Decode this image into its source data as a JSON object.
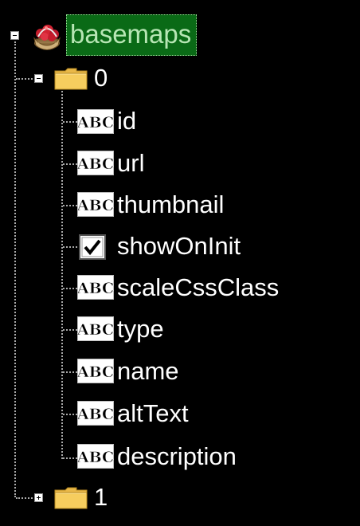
{
  "tree": {
    "root": {
      "label": "basemaps",
      "icon": "fruit-basket-icon",
      "expanded": true,
      "selected": true
    },
    "nodes": [
      {
        "label": "0",
        "icon": "folder-icon",
        "expanded": true,
        "children": [
          {
            "label": "id",
            "icon": "string-field-icon"
          },
          {
            "label": "url",
            "icon": "string-field-icon"
          },
          {
            "label": "thumbnail",
            "icon": "string-field-icon"
          },
          {
            "label": "showOnInit",
            "icon": "boolean-checkbox-icon"
          },
          {
            "label": "scaleCssClass",
            "icon": "string-field-icon"
          },
          {
            "label": "type",
            "icon": "string-field-icon"
          },
          {
            "label": "name",
            "icon": "string-field-icon"
          },
          {
            "label": "altText",
            "icon": "string-field-icon"
          },
          {
            "label": "description",
            "icon": "string-field-icon"
          }
        ]
      },
      {
        "label": "1",
        "icon": "folder-icon",
        "expanded": false
      }
    ],
    "abc_glyph": "ABC",
    "colors": {
      "background": "#000000",
      "text": "#ffffff",
      "selection_bg": "#0a6a16",
      "selection_text": "#b7e6b4",
      "folder": "#f2c24f"
    }
  }
}
